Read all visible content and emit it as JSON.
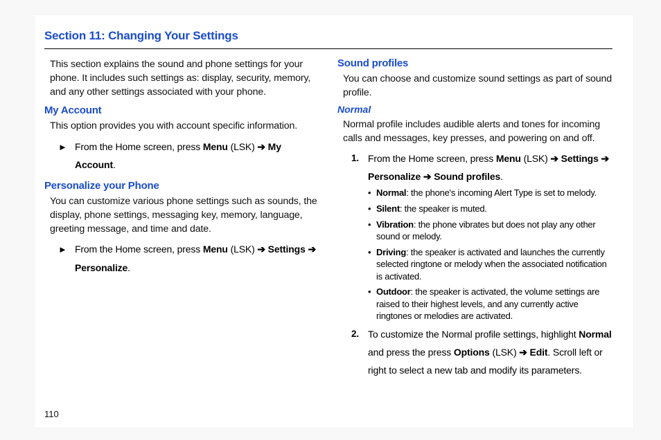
{
  "pageNumber": "110",
  "sectionTitle": "Section 11: Changing Your Settings",
  "left": {
    "intro": "This section explains the sound and phone settings for your phone. It includes such settings as: display, security, memory, and any other settings associated with your phone.",
    "myAccount": {
      "heading": "My Account",
      "body": "This option provides you with account specific information.",
      "step_prefix": "From the Home screen, press ",
      "menu": "Menu",
      "lsk": " (LSK) ",
      "arrow": "➔",
      "target": " My Account",
      "period": "."
    },
    "personalize": {
      "heading": "Personalize your Phone",
      "body": "You can customize various phone settings such as sounds, the display, phone settings, messaging key, memory, language, greeting message, and time and date.",
      "step_prefix": "From the Home screen, press ",
      "menu": "Menu",
      "lsk": " (LSK) ",
      "arrow1": "➔",
      "settings": " Settings ",
      "arrow2": "➔",
      "personalizeWord": "Personalize",
      "period": "."
    }
  },
  "right": {
    "sound": {
      "heading": "Sound profiles",
      "body": "You can choose and customize sound settings as part of sound profile."
    },
    "normal": {
      "heading": "Normal",
      "body": "Normal profile includes audible alerts and tones for incoming calls and messages, key presses, and powering on and off.",
      "step1_prefix": "From the Home screen, press ",
      "menu": "Menu",
      "lsk": " (LSK) ",
      "arrow1": "➔",
      "settings": " Settings ",
      "arrow2": "➔",
      "personalize": "Personalize ",
      "arrow3": "➔",
      "soundProfiles": " Sound profiles",
      "period": ".",
      "bullets": {
        "normal_label": "Normal",
        "normal_text": ": the phone's incoming Alert Type is set to melody.",
        "silent_label": "Silent",
        "silent_text": ": the speaker is muted.",
        "vibration_label": "Vibration",
        "vibration_text": ": the phone vibrates but does not play any other sound or melody.",
        "driving_label": "Driving",
        "driving_text": ": the speaker is activated and launches the currently selected ringtone or melody when the associated notification is activated.",
        "outdoor_label": "Outdoor",
        "outdoor_text": ": the speaker is activated, the volume settings are raised to their highest levels, and any currently active ringtones or melodies are activated."
      },
      "step2_a": "To customize the Normal profile settings, highlight ",
      "step2_normal": "Normal",
      "step2_b": " and press the press ",
      "step2_options": "Options",
      "step2_lsk": " (LSK) ",
      "step2_arrow": "➔",
      "step2_edit": " Edit",
      "step2_c": ". Scroll left or right to select a new tab and modify its parameters."
    }
  },
  "num1": "1.",
  "num2": "2.",
  "mark": "►"
}
